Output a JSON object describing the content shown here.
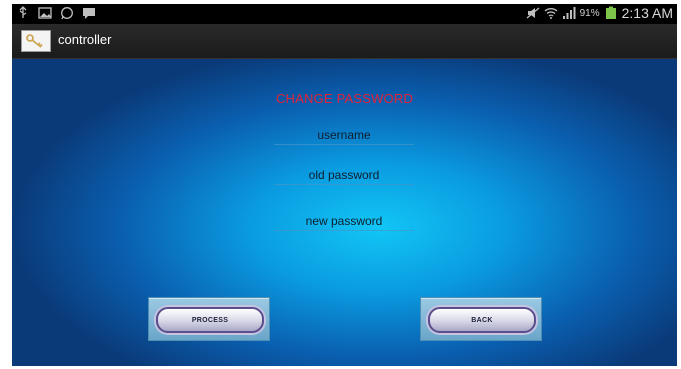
{
  "status_bar": {
    "left_icons": [
      "usb-icon",
      "image-icon",
      "whatsapp-icon",
      "chat-icon"
    ],
    "right_icons": [
      "mute-icon",
      "wifi-icon",
      "signal-icon",
      "battery-icon"
    ],
    "battery_percent": "91%",
    "time": "2:13 AM"
  },
  "action_bar": {
    "app_icon": "key-icon",
    "title": "controller"
  },
  "form": {
    "title": "CHANGE PASSWORD",
    "title_color": "#e2233a",
    "fields": {
      "username": "username",
      "old_password": "old password",
      "new_password": "new password"
    }
  },
  "buttons": {
    "process": "PROCESS",
    "back": "BACK"
  }
}
